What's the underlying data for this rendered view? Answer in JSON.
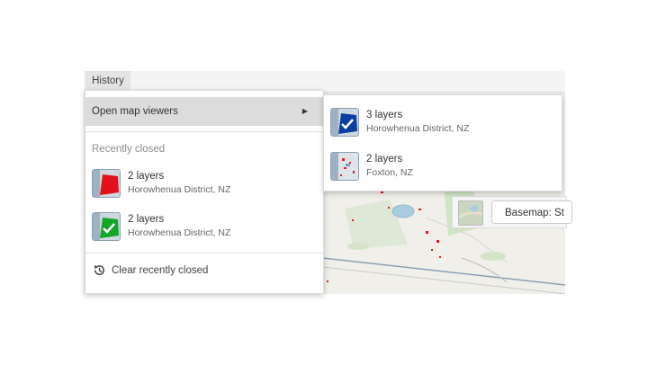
{
  "topbar": {
    "history_label": "History"
  },
  "history_menu": {
    "open_viewers_label": "Open map viewers",
    "recently_closed_heading": "Recently closed",
    "recent_items": [
      {
        "title": "2 layers",
        "place": "Horowhenua District, NZ",
        "thumb_color": "#e3101a"
      },
      {
        "title": "2 layers",
        "place": "Horowhenua District, NZ",
        "thumb_color": "#12a528"
      }
    ],
    "clear_label": "Clear recently closed"
  },
  "open_viewers_submenu": {
    "items": [
      {
        "title": "3 layers",
        "place": "Horowhenua District, NZ",
        "thumb_color": "#0a3fa0"
      },
      {
        "title": "2 layers",
        "place": "Foxton, NZ",
        "thumb_color": "#d9212a"
      }
    ]
  },
  "basemap": {
    "label": "Basemap: St"
  },
  "icons": {
    "submenu_arrow": "caret-right-icon",
    "clear": "history-icon",
    "check": "check-icon"
  }
}
